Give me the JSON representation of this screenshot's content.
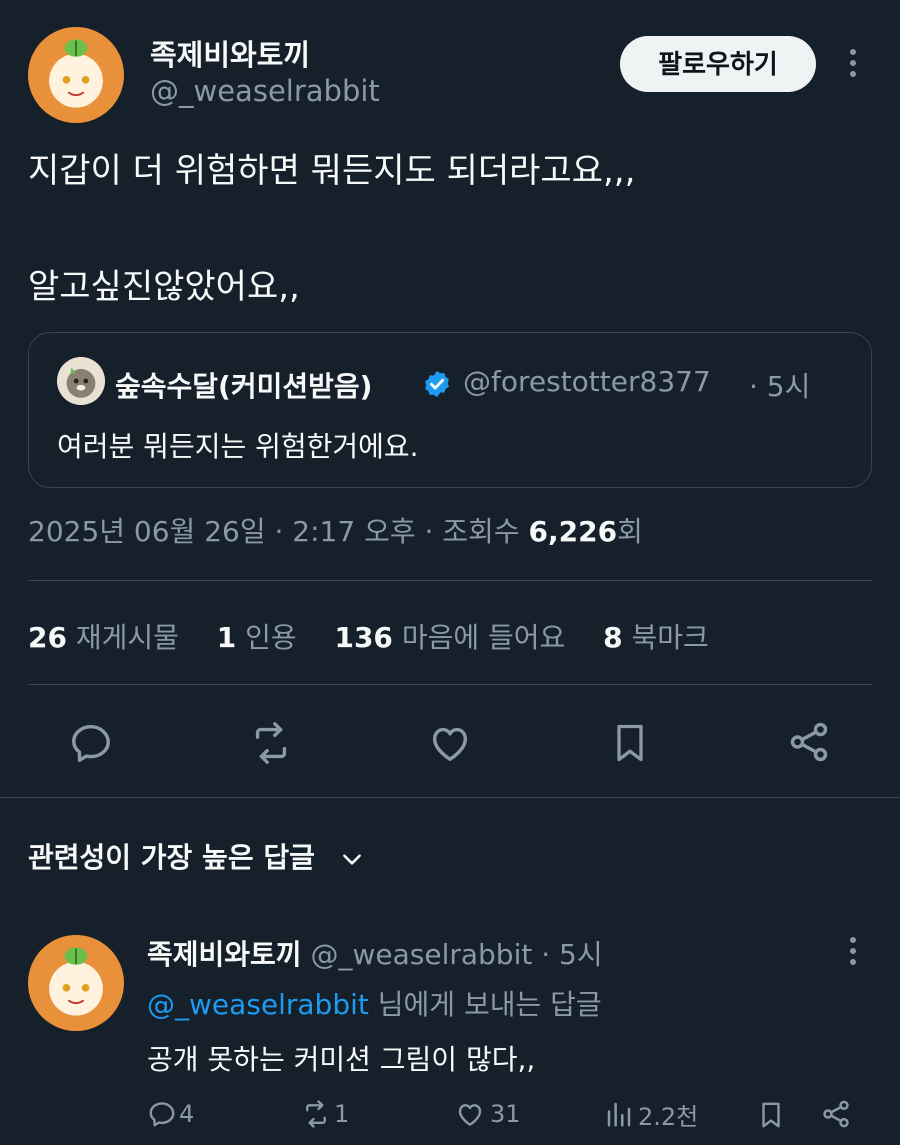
{
  "tweet": {
    "author_name": "족제비와토끼",
    "author_handle": "@_weaselrabbit",
    "follow_label": "팔로우하기",
    "text_line1": "지갑이 더 위험하면 뭐든지도 되더라고요,,,",
    "text_line2": "알고싶진않았어요,,",
    "quote": {
      "author_name": "숲속수달(커미션받음)",
      "author_handle": "@forestotter8377",
      "time": "· 5시",
      "text": "여러분 뭐든지는 위험한거에요."
    },
    "meta_datetime": "2025년 06월 26일 · 2:17 오후 · 조회수 ",
    "views_count": "6,226",
    "views_suffix": "회",
    "stats": {
      "retweets_count": "26",
      "retweets_label": "재게시물",
      "quotes_count": "1",
      "quotes_label": "인용",
      "likes_count": "136",
      "likes_label": "마음에 들어요",
      "bookmarks_count": "8",
      "bookmarks_label": "북마크"
    }
  },
  "replies_sort_label": "관련성이 가장 높은 답글",
  "reply": {
    "author_name": "족제비와토끼",
    "author_handle": "@_weaselrabbit",
    "time": "· 5시",
    "replying_to_handle": "@_weaselrabbit",
    "replying_to_suffix": " 님에게 보내는 답글",
    "text": "공개 못하는 커미션 그림이 많다,,",
    "reply_count": "4",
    "retweet_count": "1",
    "like_count": "31",
    "view_count": "2.2천"
  },
  "colors": {
    "background": "#15202b",
    "text": "#f7f9f9",
    "muted": "#8b98a5",
    "link": "#1d9bf0",
    "border": "#38444d"
  }
}
